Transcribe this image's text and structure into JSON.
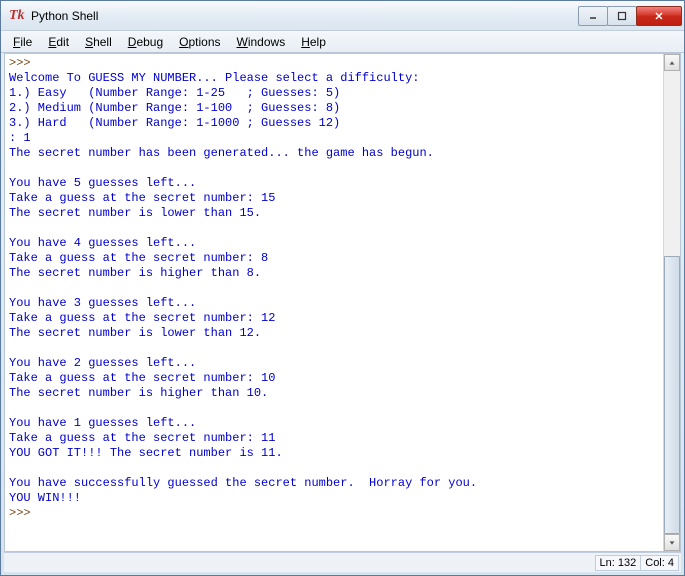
{
  "window": {
    "title": "Python Shell"
  },
  "menu": {
    "file": "File",
    "edit": "Edit",
    "shell": "Shell",
    "debug": "Debug",
    "options": "Options",
    "windows": "Windows",
    "help": "Help"
  },
  "console": {
    "prompt": ">>> ",
    "lines": [
      "Welcome To GUESS MY NUMBER... Please select a difficulty:",
      "1.) Easy   (Number Range: 1-25   ; Guesses: 5)",
      "2.) Medium (Number Range: 1-100  ; Guesses: 8)",
      "3.) Hard   (Number Range: 1-1000 ; Guesses 12)",
      ": 1",
      "The secret number has been generated... the game has begun.",
      "",
      "You have 5 guesses left...",
      "Take a guess at the secret number: 15",
      "The secret number is lower than 15.",
      "",
      "You have 4 guesses left...",
      "Take a guess at the secret number: 8",
      "The secret number is higher than 8.",
      "",
      "You have 3 guesses left...",
      "Take a guess at the secret number: 12",
      "The secret number is lower than 12.",
      "",
      "You have 2 guesses left...",
      "Take a guess at the secret number: 10",
      "The secret number is higher than 10.",
      "",
      "You have 1 guesses left...",
      "Take a guess at the secret number: 11",
      "YOU GOT IT!!! The secret number is 11.",
      "",
      "You have successfully guessed the secret number.  Horray for you.",
      "YOU WIN!!!"
    ]
  },
  "status": {
    "line": "Ln: 132",
    "col": "Col: 4"
  }
}
